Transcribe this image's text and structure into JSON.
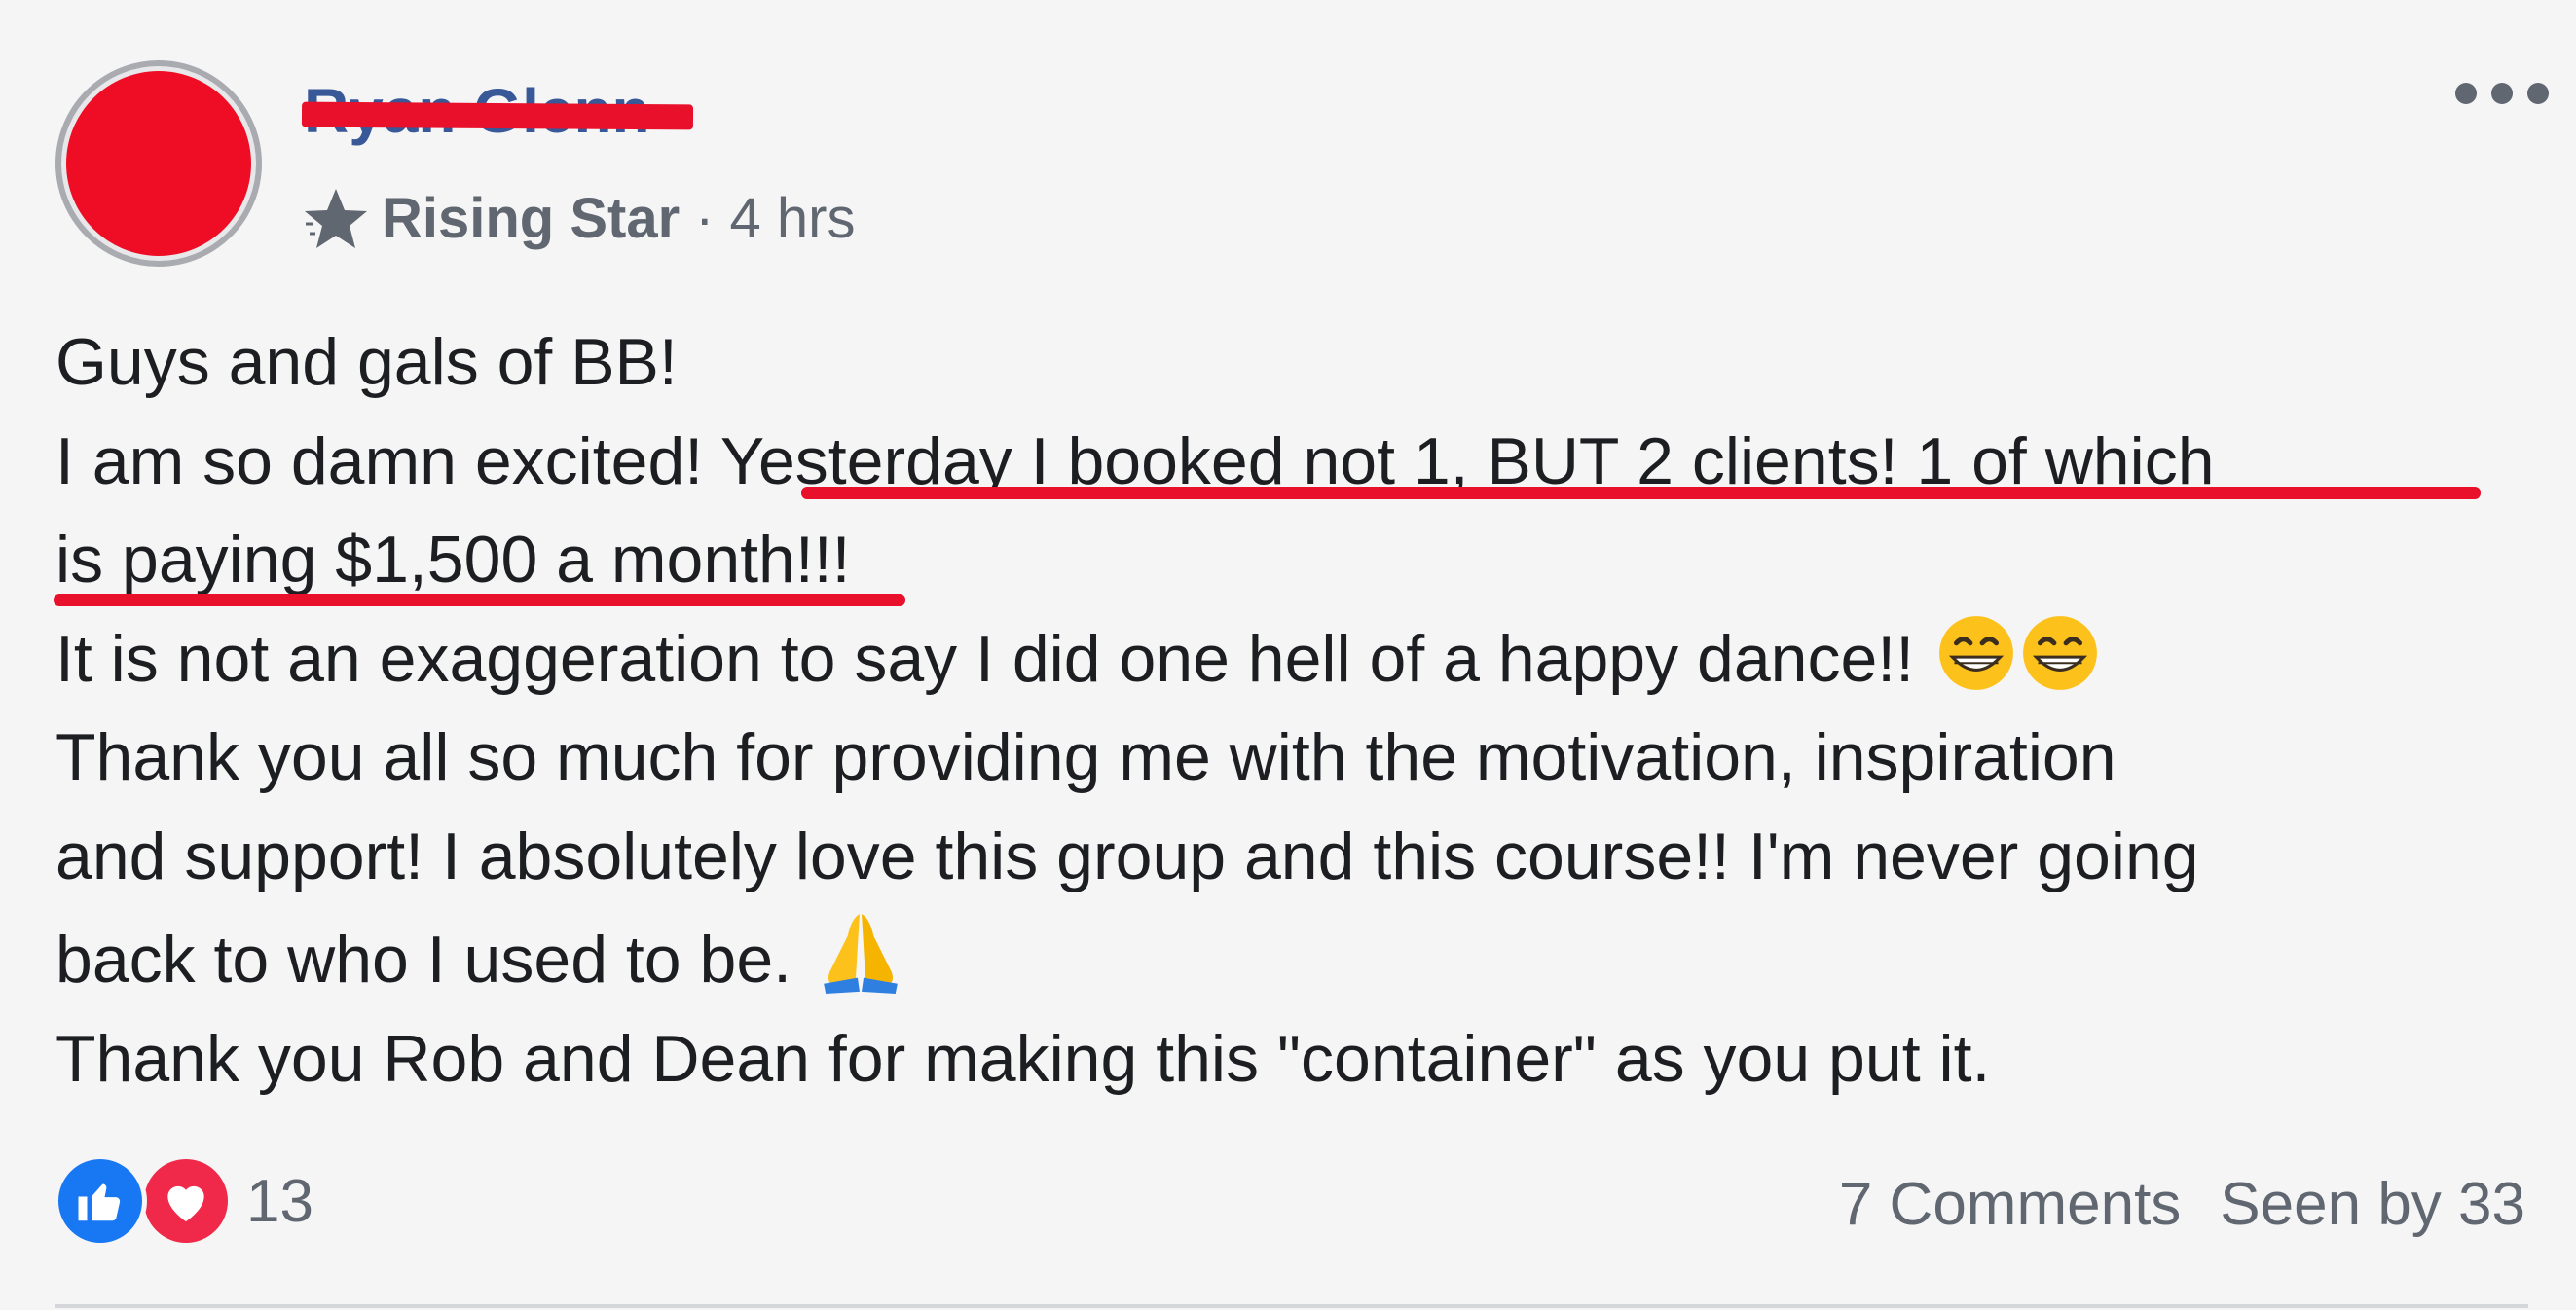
{
  "post": {
    "author_name": "Ryan Glenn",
    "badge": "Rising Star",
    "separator": "·",
    "timestamp": "4 hrs",
    "body": {
      "line1": "Guys and gals of BB!",
      "line2_plain": "I am so damn excited! ",
      "line2_highlight": "Yesterday I booked not 1, BUT 2 clients! 1 of which",
      "line3_highlight": "is paying $1,500 a month",
      "line3_rest": "!!!",
      "line4": "It is not an exaggeration to say I did one hell of a happy dance!! ",
      "line5": "Thank you all so much for providing me with the motivation, inspiration",
      "line6": "and support! I absolutely love this group and this course!! I'm never going",
      "line7": "back to who I used to be. ",
      "line8": "Thank you Rob and Dean for making this \"container\" as you put it."
    },
    "reactions": {
      "count": "13",
      "types": [
        "like-icon",
        "love-icon"
      ]
    },
    "comments_label": "7 Comments",
    "seen_label": "Seen by 33"
  },
  "colors": {
    "background": "#f5f5f6",
    "name": "#385898",
    "redaction": "#e8102a",
    "meta": "#606770",
    "like": "#1877f2",
    "love": "#f0284a"
  }
}
